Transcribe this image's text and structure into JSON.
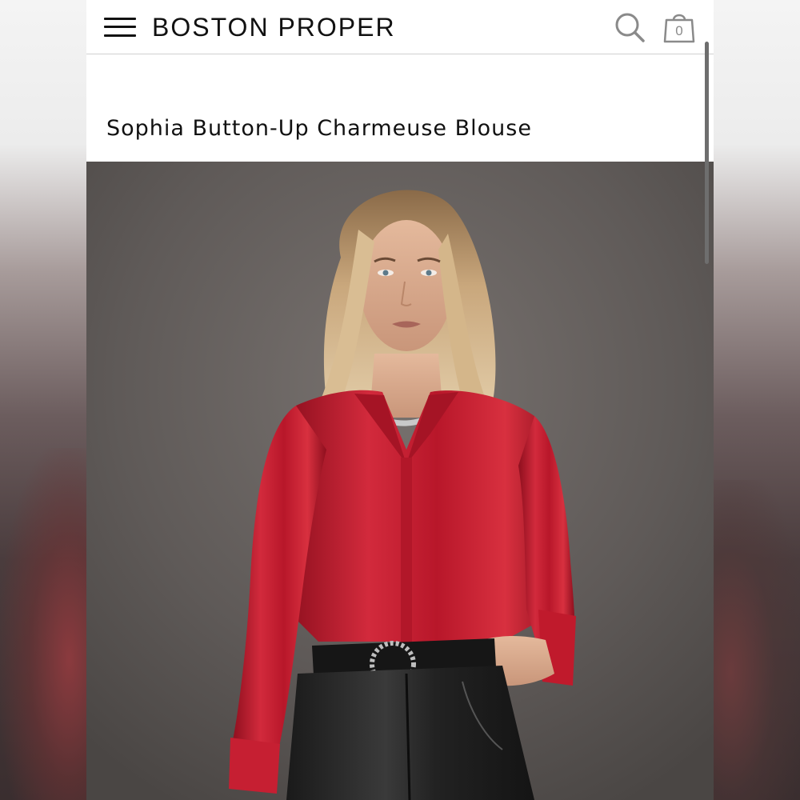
{
  "header": {
    "brand": "BOSTON PROPER",
    "menu_icon": "hamburger-menu-icon",
    "search_icon": "search-icon",
    "cart_icon": "shopping-bag-icon",
    "cart_count": "0"
  },
  "product": {
    "title": "Sophia Button-Up Charmeuse Blouse",
    "image_alt": "Model wearing red charmeuse button-up blouse with black leather pants and jeweled belt"
  },
  "colors": {
    "blouse": "#c01a2c",
    "background": "#5e5957",
    "text": "#111111"
  }
}
